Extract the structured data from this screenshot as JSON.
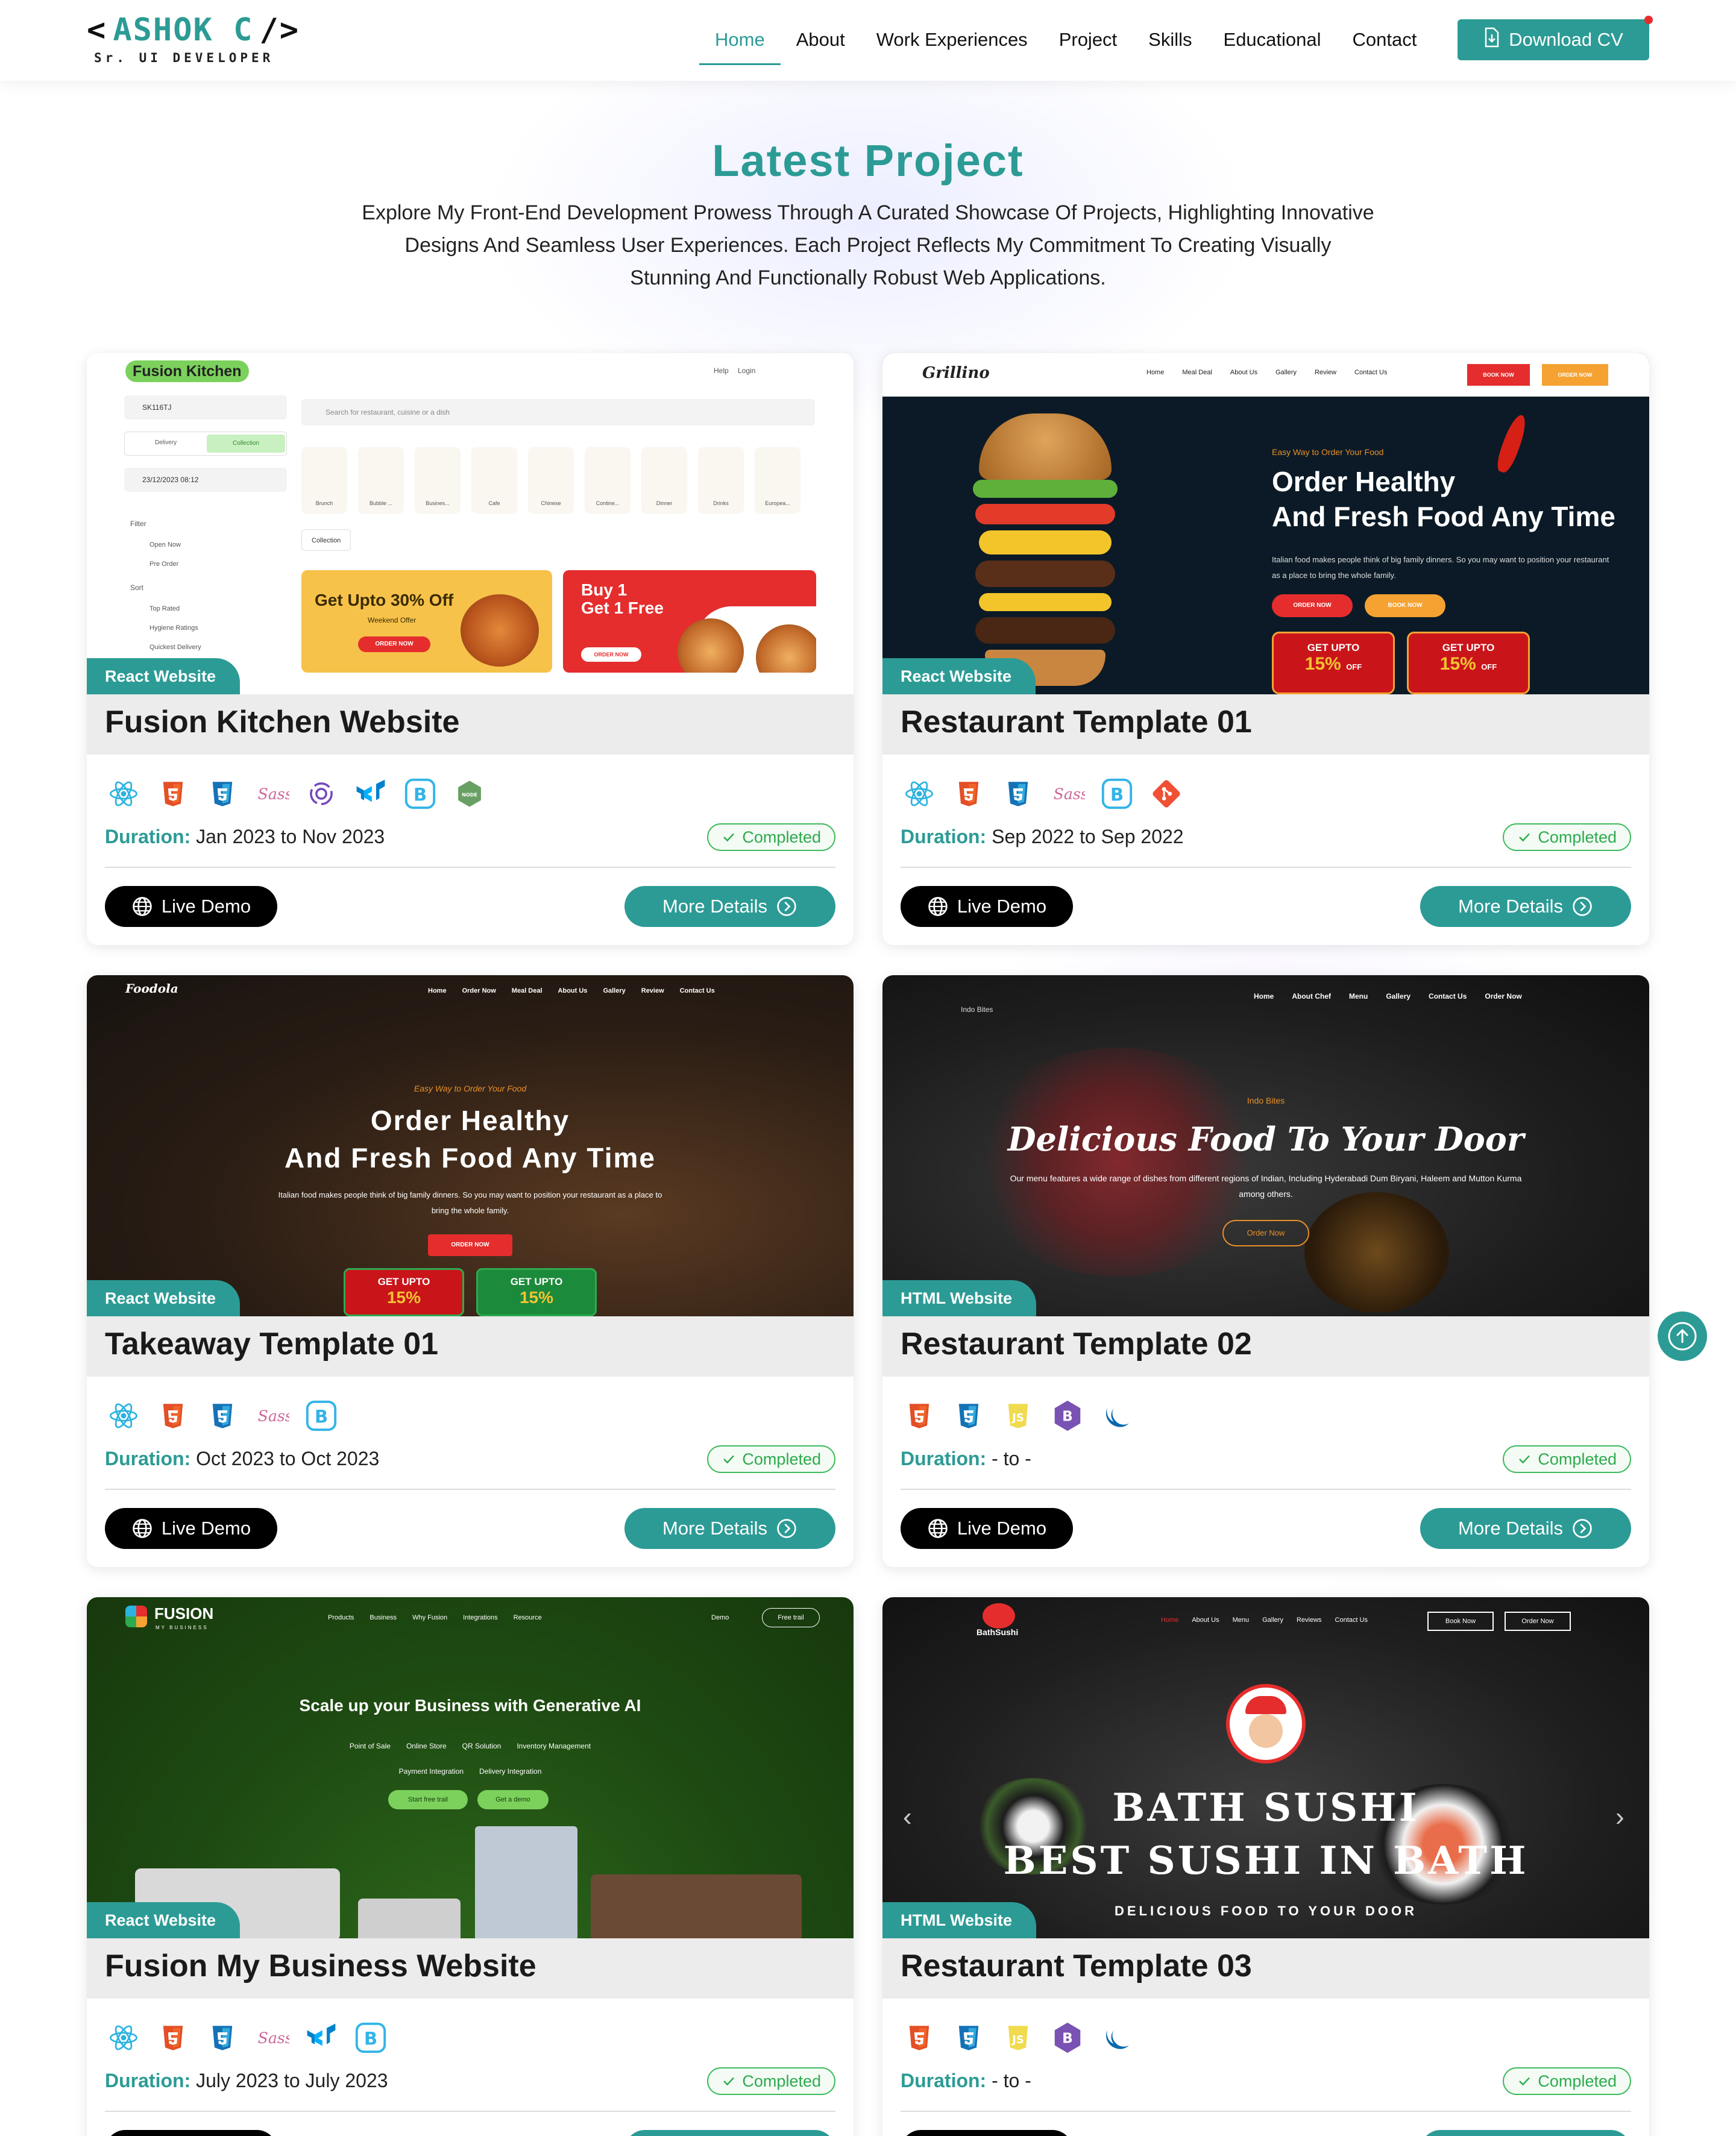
{
  "header": {
    "logo_name": "ASHOK C",
    "logo_left": "<",
    "logo_right": "/>",
    "logo_subtitle": "Sr. UI DEVELOPER",
    "nav": [
      "Home",
      "About",
      "Work Experiences",
      "Project",
      "Skills",
      "Educational",
      "Contact"
    ],
    "active_nav": "Home",
    "download_cv": "Download CV"
  },
  "section": {
    "title": "Latest Project",
    "description": "Explore My Front-End Development Prowess Through A Curated Showcase Of Projects, Highlighting Innovative Designs And Seamless User Experiences. Each Project Reflects My Commitment To Creating Visually Stunning And Functionally Robust Web Applications."
  },
  "labels": {
    "duration": "Duration:",
    "live_demo": "Live Demo",
    "more_details": "More Details"
  },
  "projects": [
    {
      "title": "Fusion Kitchen Website",
      "badge": "React Website",
      "techs": [
        "react-icon",
        "html5-icon",
        "css3-icon",
        "sass-icon",
        "redux-icon",
        "mui-icon",
        "bootstrap-icon",
        "node-icon"
      ],
      "duration": "Jan 2023 to Nov 2023",
      "status": "Completed",
      "thumb": {
        "brand": "Fusion Kitchen",
        "links": [
          "Help",
          "Login"
        ],
        "postcode": "SK116TJ",
        "toggle": [
          "Delivery",
          "Collection"
        ],
        "datetime": "23/12/2023 08:12",
        "search": "Search for restaurant, cuisine or a dish",
        "categories": [
          "Brunch",
          "Bubble ...",
          "Busines...",
          "Cafe",
          "Chinese",
          "Contine...",
          "Dinner",
          "Drinks",
          "Europea..."
        ],
        "filter": "Filter",
        "filter_items": [
          "Open Now",
          "Pre Order"
        ],
        "sort": "Sort",
        "sort_items": [
          "Top Rated",
          "Hygiene Ratings",
          "Quickest Delivery"
        ],
        "collection": "Collection",
        "promo1_title": "Get Upto 30% Off",
        "promo1_sub": "Weekend Offer",
        "promo1_btn": "ORDER NOW",
        "promo2_title": "Buy 1\nGet 1 Free",
        "promo2_btn": "ORDER NOW"
      }
    },
    {
      "title": "Restaurant Template 01",
      "badge": "React Website",
      "techs": [
        "react-icon",
        "html5-icon",
        "css3-icon",
        "sass-icon",
        "bootstrap-icon",
        "git-icon"
      ],
      "duration": "Sep 2022 to Sep 2022",
      "status": "Completed",
      "thumb": {
        "brand": "Grillino",
        "links": [
          "Home",
          "Meal Deal",
          "About Us",
          "Gallery",
          "Review",
          "Contact Us"
        ],
        "book": "BOOK NOW",
        "order": "ORDER NOW",
        "eyebrow": "Easy Way to Order Your Food",
        "headline1": "Order Healthy",
        "headline2": "And Fresh Food Any Time",
        "body": "Italian food makes people think of big family dinners. So you may want to position your restaurant as a place to bring the whole family.",
        "offer": "GET UPTO",
        "pct": "15%",
        "off": "OFF"
      }
    },
    {
      "title": "Takeaway Template 01",
      "badge": "React Website",
      "techs": [
        "react-icon",
        "html5-icon",
        "css3-icon",
        "sass-icon",
        "bootstrap-icon"
      ],
      "duration": "Oct 2023 to Oct 2023",
      "status": "Completed",
      "thumb": {
        "brand": "Foodola",
        "links": [
          "Home",
          "Order Now",
          "Meal Deal",
          "About Us",
          "Gallery",
          "Review",
          "Contact Us"
        ],
        "eyebrow": "Easy Way to Order Your Food",
        "headline1": "Order Healthy",
        "headline2": "And Fresh Food Any Time",
        "body": "Italian food makes people think of big family dinners. So you may want to position your restaurant as a place to bring the whole family.",
        "cta": "ORDER NOW",
        "offer": "GET UPTO",
        "pct": "15%"
      }
    },
    {
      "title": "Restaurant Template 02",
      "badge": "HTML Website",
      "techs": [
        "html5-icon",
        "css3-icon",
        "javascript-icon",
        "bootstrap-icon",
        "jquery-icon"
      ],
      "duration": "- to -",
      "status": "Completed",
      "thumb": {
        "brand": "Indo Bites",
        "links": [
          "Home",
          "About Chef",
          "Menu",
          "Gallery",
          "Contact Us",
          "Order Now"
        ],
        "eyebrow": "Indo Bites",
        "headline": "Delicious Food To Your Door",
        "body": "Our menu features a wide range of dishes from different regions of Indian, Including Hyderabadi Dum Biryani, Haleem and Mutton Kurma among others.",
        "cta": "Order Now"
      }
    },
    {
      "title": "Fusion My Business Website",
      "badge": "React Website",
      "techs": [
        "react-icon",
        "html5-icon",
        "css3-icon",
        "sass-icon",
        "mui-icon",
        "bootstrap-icon"
      ],
      "duration": "July 2023 to July 2023",
      "status": "Completed",
      "thumb": {
        "brand": "FUSION",
        "brand_sub": "MY BUSINESS",
        "links": [
          "Products",
          "Business",
          "Why Fusion",
          "Integrations",
          "Resource"
        ],
        "demo": "Demo",
        "trial": "Free trail",
        "headline": "Scale up your Business with Generative AI",
        "features1": [
          "Point of Sale",
          "Online Store",
          "QR Solution",
          "Inventory Management"
        ],
        "features2": [
          "Payment Integration",
          "Delivery Integration"
        ],
        "cta1": "Start free trail",
        "cta2": "Get a demo"
      }
    },
    {
      "title": "Restaurant Template 03",
      "badge": "HTML Website",
      "techs": [
        "html5-icon",
        "css3-icon",
        "javascript-icon",
        "bootstrap-icon",
        "jquery-icon"
      ],
      "duration": "- to -",
      "status": "Completed",
      "thumb": {
        "brand": "BathSushi",
        "links": [
          "Home",
          "About Us",
          "Menu",
          "Gallery",
          "Reviews",
          "Contact Us"
        ],
        "book": "Book Now",
        "order": "Order Now",
        "headline1": "BATH SUSHI",
        "headline2": "BEST SUSHI IN BATH",
        "tagline": "DELICIOUS FOOD TO YOUR DOOR"
      }
    }
  ],
  "colors": {
    "accent": "#2c9b95",
    "completed": "#2eaa4e"
  }
}
